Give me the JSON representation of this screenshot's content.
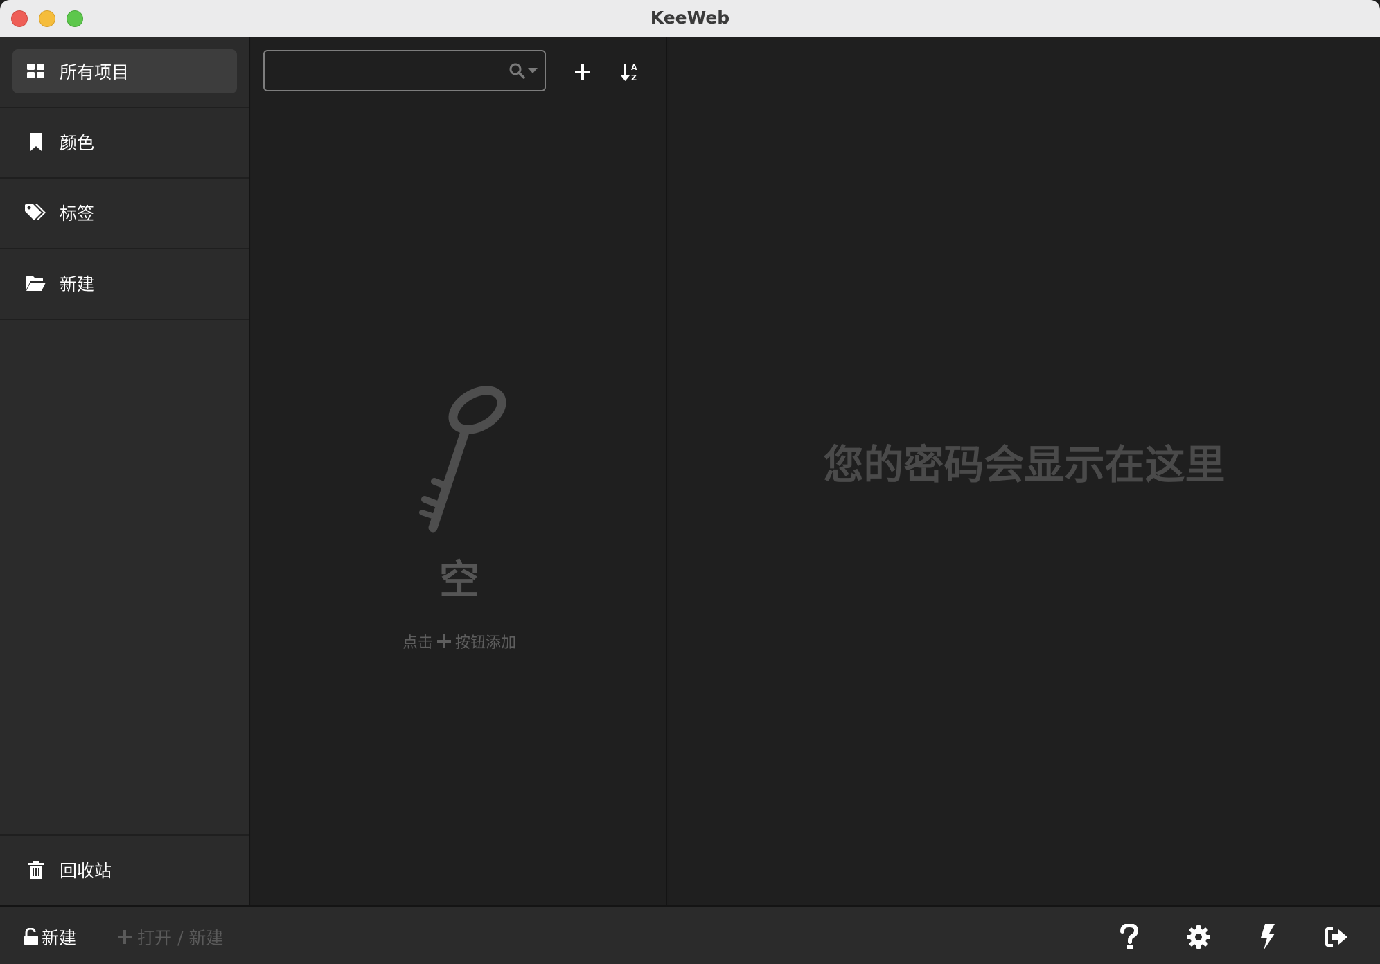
{
  "window": {
    "title": "KeeWeb"
  },
  "sidebar": {
    "items": [
      {
        "label": "所有项目",
        "icon": "grid-icon",
        "active": true
      },
      {
        "label": "颜色",
        "icon": "bookmark-icon",
        "active": false
      },
      {
        "label": "标签",
        "icon": "tags-icon",
        "active": false
      },
      {
        "label": "新建",
        "icon": "folder-open-icon",
        "active": false
      }
    ],
    "trash": {
      "label": "回收站",
      "icon": "trash-icon"
    }
  },
  "list": {
    "search": {
      "value": "",
      "placeholder": ""
    },
    "add_button_icon": "plus-icon",
    "sort_button_icon": "sort-alpha-icon",
    "empty": {
      "title": "空",
      "hint_before": "点击",
      "hint_after": "按钮添加"
    }
  },
  "detail": {
    "placeholder": "您的密码会显示在这里"
  },
  "footer": {
    "file_label": "新建",
    "open_label": "打开 / 新建",
    "buttons": [
      "help-icon",
      "settings-icon",
      "generate-icon",
      "lock-exit-icon"
    ]
  },
  "colors": {
    "background": "#1e1e1e",
    "sidebar": "#2b2b2b",
    "active_item": "#3d3d3d",
    "muted_text": "#555555"
  }
}
